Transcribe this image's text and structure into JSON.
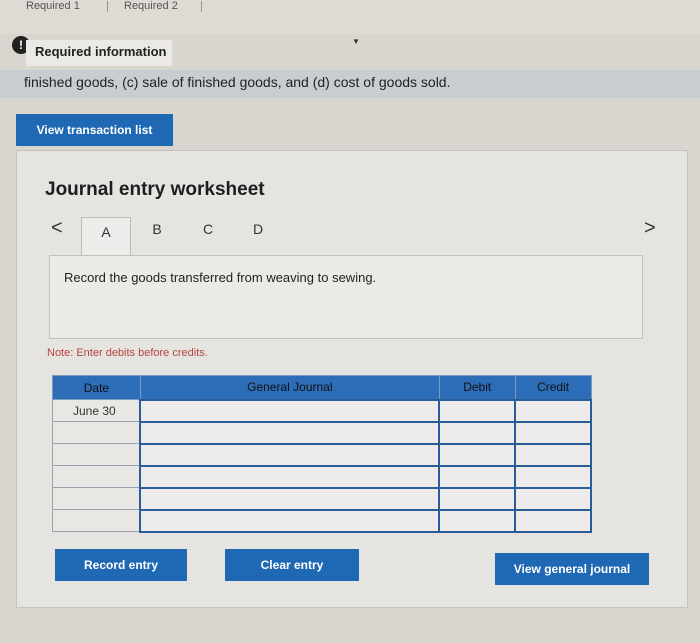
{
  "top_tabs": {
    "tab1": "Required 1",
    "tab2": "Required 2",
    "separator": "|"
  },
  "alert": {
    "icon_glyph": "!",
    "label": "Required information"
  },
  "info_bar": {
    "text": "finished goods, (c) sale of finished goods, and (d) cost of goods sold."
  },
  "buttons": {
    "view_transaction_list": "View transaction list",
    "record_entry": "Record entry",
    "clear_entry": "Clear entry",
    "view_general_journal": "View general journal"
  },
  "worksheet": {
    "title": "Journal entry worksheet",
    "prev": "<",
    "next": ">",
    "tabs": [
      "A",
      "B",
      "C",
      "D"
    ],
    "active_tab": "A",
    "description": "Record the goods transferred from weaving to sewing.",
    "note": "Note: Enter debits before credits."
  },
  "table": {
    "headers": [
      "Date",
      "General Journal",
      "Debit",
      "Credit"
    ],
    "rows": [
      {
        "date": "June 30",
        "journal": "",
        "debit": "",
        "credit": ""
      },
      {
        "date": "",
        "journal": "",
        "debit": "",
        "credit": ""
      },
      {
        "date": "",
        "journal": "",
        "debit": "",
        "credit": ""
      },
      {
        "date": "",
        "journal": "",
        "debit": "",
        "credit": ""
      },
      {
        "date": "",
        "journal": "",
        "debit": "",
        "credit": ""
      },
      {
        "date": "",
        "journal": "",
        "debit": "",
        "credit": ""
      }
    ]
  },
  "colors": {
    "primary_button": "#1f68b3",
    "table_header": "#2d6db8",
    "note": "#b3453c"
  }
}
